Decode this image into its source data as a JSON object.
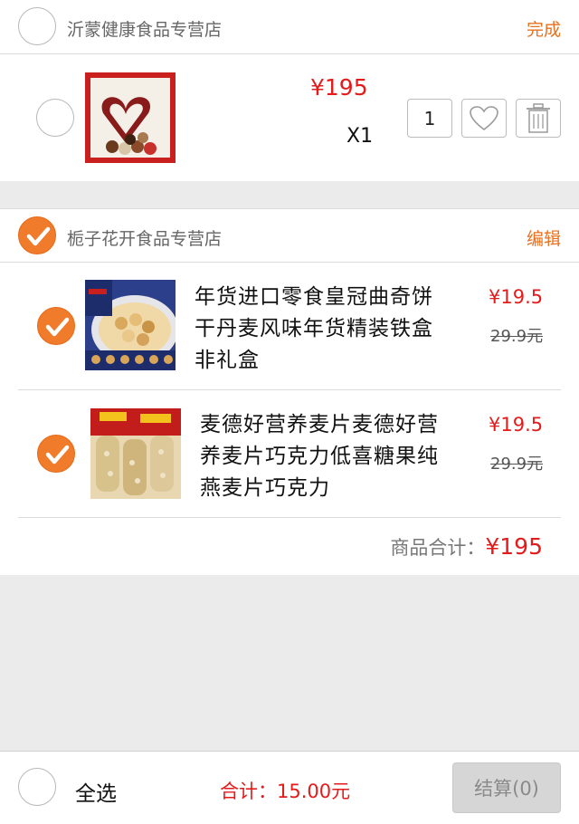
{
  "shops": [
    {
      "name": "沂蒙健康食品专营店",
      "action": "完成",
      "selected": false,
      "item": {
        "price": "¥195",
        "count": "X1",
        "quantity": "1",
        "selected": false
      }
    },
    {
      "name": "栀子花开食品专营店",
      "action": "编辑",
      "selected": true,
      "items": [
        {
          "title_lines": [
            "年货进口零食皇冠曲奇饼",
            "干丹麦风味年货精装铁盒",
            "非礼盒"
          ],
          "price": "¥19.5",
          "original_price": "29.9元",
          "selected": true
        },
        {
          "title_lines": [
            "麦德好营养麦片麦德好营",
            "养麦片巧克力低喜糖果纯",
            "燕麦片巧克力"
          ],
          "price": "¥19.5",
          "original_price": "29.9元",
          "selected": true
        }
      ],
      "subtotal_label": "商品合计：",
      "subtotal_value": "¥195"
    }
  ],
  "footer": {
    "select_all_label": "全选",
    "total_label": "合计：",
    "total_value": "15.00元",
    "checkout_label": "结算(0)"
  },
  "colors": {
    "accent_orange": "#f07b2a",
    "price_red": "#e41b1b",
    "action_orange": "#e8701f"
  }
}
